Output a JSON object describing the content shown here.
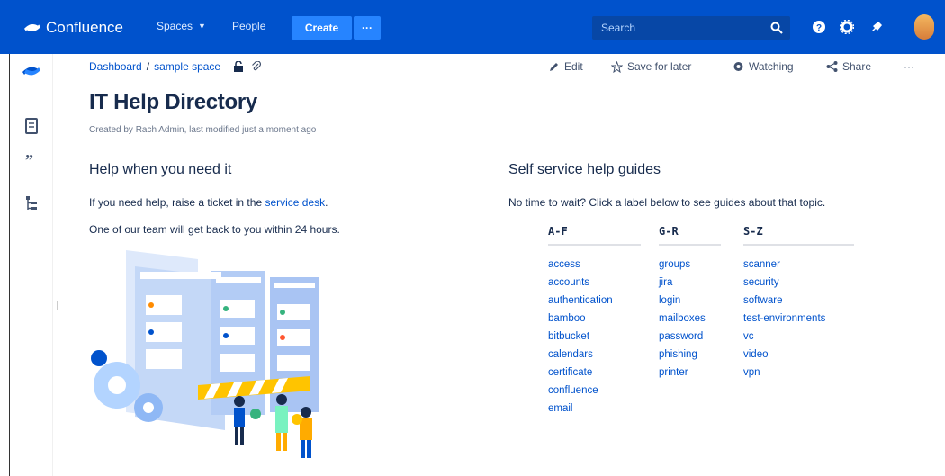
{
  "topnav": {
    "brand": "Confluence",
    "spaces_label": "Spaces",
    "people_label": "People",
    "create_label": "Create",
    "more_label": "···",
    "search_placeholder": "Search"
  },
  "breadcrumb": {
    "dashboard": "Dashboard",
    "separator": "/",
    "space": "sample space"
  },
  "page_actions": {
    "edit": "Edit",
    "save_for_later": "Save for later",
    "watching": "Watching",
    "share": "Share",
    "more": "···"
  },
  "page": {
    "title": "IT Help Directory",
    "byline": "Created by Rach Admin, last modified just a moment ago"
  },
  "left_section": {
    "heading": "Help when you need it",
    "para1_prefix": "If you need help, raise a ticket in the ",
    "para1_link": "service desk",
    "para1_suffix": ".",
    "para2": "One of our team will get back to you within 24 hours."
  },
  "right_section": {
    "heading": "Self service help guides",
    "intro": "No time to wait? Click a label below to see guides about that topic.",
    "columns": [
      {
        "header": "A-F",
        "labels": [
          "access",
          "accounts",
          "authentication",
          "bamboo",
          "bitbucket",
          "calendars",
          "certificate",
          "confluence",
          "email"
        ]
      },
      {
        "header": "G-R",
        "labels": [
          "groups",
          "jira",
          "login",
          "mailboxes",
          "password",
          "phishing",
          "printer"
        ]
      },
      {
        "header": "S-Z",
        "labels": [
          "scanner",
          "security",
          "software",
          "test-environments",
          "vc",
          "video",
          "vpn"
        ]
      }
    ]
  },
  "colors": {
    "nav_bg": "#0052cc",
    "create_bg": "#2684ff",
    "link": "#0052cc",
    "text": "#172b4d"
  },
  "icons": [
    "confluence-logo-icon",
    "search-icon",
    "help-icon",
    "settings-icon",
    "notifications-icon",
    "pages-icon",
    "blog-icon",
    "page-tree-icon",
    "restrictions-icon",
    "attachments-icon",
    "pencil-icon",
    "star-icon",
    "eye-icon",
    "share-icon"
  ]
}
